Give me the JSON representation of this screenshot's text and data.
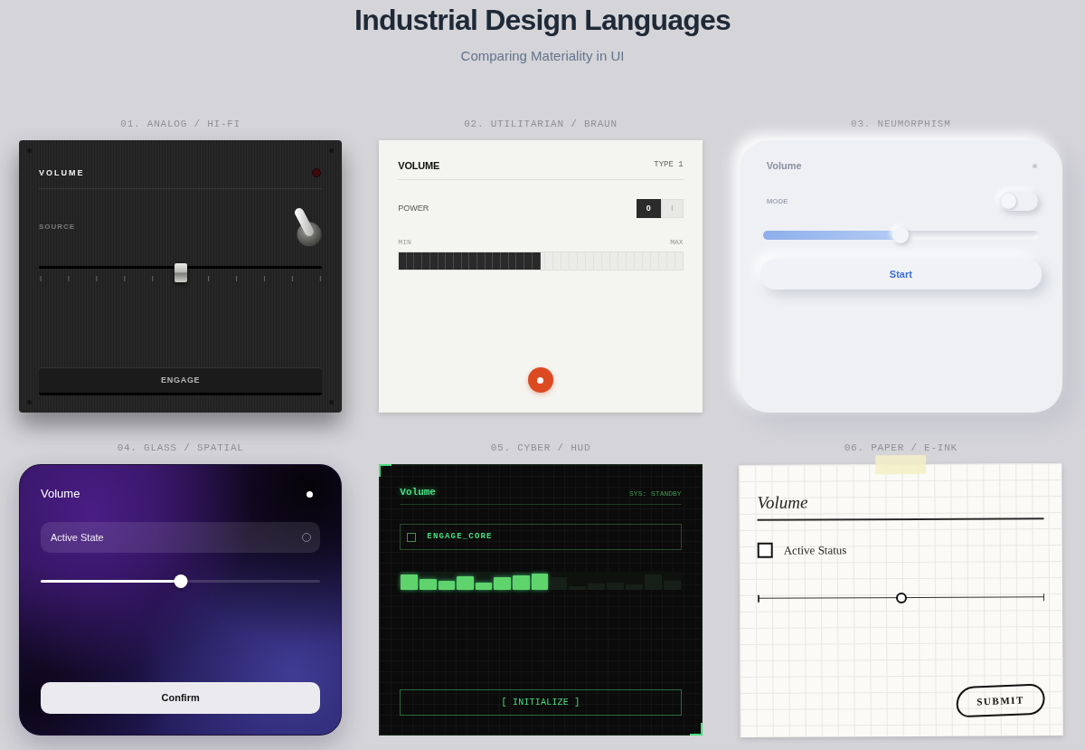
{
  "header": {
    "title": "Industrial Design Languages",
    "subtitle": "Comparing Materiality in UI"
  },
  "panels": [
    {
      "kind": "analog",
      "label": "01. ANALOG / HI-FI",
      "title": "VOLUME",
      "indicator_on": false,
      "switch": {
        "label": "SOURCE",
        "on": false
      },
      "slider": {
        "level": 0.5
      },
      "button": "ENGAGE"
    },
    {
      "kind": "utilitarian",
      "label": "02. UTILITARIAN / BRAUN",
      "title": "VOLUME",
      "model": "TYPE 1",
      "power": {
        "label": "POWER",
        "options": [
          {
            "label": "0",
            "selected": true
          },
          {
            "label": "I",
            "selected": false
          }
        ]
      },
      "meter": {
        "min_label": "MIN",
        "max_label": "MAX",
        "level": 0.5
      }
    },
    {
      "kind": "neumorphic",
      "label": "03. NEUMORPHISM",
      "title": "Volume",
      "indicator_on": false,
      "toggle": {
        "label": "MODE",
        "on": false
      },
      "slider": {
        "level": 0.5
      },
      "button": "Start"
    },
    {
      "kind": "glass",
      "label": "04. GLASS / SPATIAL",
      "title": "Volume",
      "option": {
        "label": "Active State",
        "checked": false
      },
      "slider": {
        "level": 0.5
      },
      "button": "Confirm"
    },
    {
      "kind": "cyber",
      "label": "05. CYBER / HUD",
      "title": "Volume",
      "status": "SYS: STANDBY",
      "checkbox": {
        "label": "ENGAGE_CORE",
        "checked": false
      },
      "meter": {
        "level": 0.53
      },
      "button": "[ INITIALIZE ]"
    },
    {
      "kind": "paper",
      "label": "06. PAPER / E-INK",
      "title": "Volume",
      "checkbox": {
        "label": "Active Status",
        "checked": false
      },
      "slider": {
        "level": 0.5
      },
      "button": "SUBMIT"
    }
  ]
}
